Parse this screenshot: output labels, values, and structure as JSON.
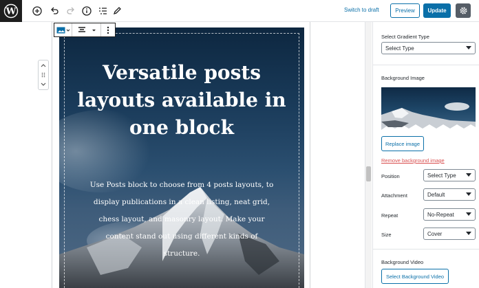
{
  "topbar": {
    "switch_to_draft": "Switch to draft",
    "preview": "Preview",
    "update": "Update"
  },
  "cover": {
    "title": "Versatile posts layouts available in one block",
    "text": "Use Posts block to choose from 4 posts layouts, to display publications in a clean listing, neat grid, chess layout, and masonry layout. Make your content stand out using different kinds of structure."
  },
  "sidebar": {
    "gradient_type_label": "Select Gradient Type",
    "gradient_type_value": "Select Type",
    "background_image_label": "Background Image",
    "replace_image": "Replace image",
    "remove_background_image": "Remove background image",
    "position_label": "Position",
    "position_value": "Select Type",
    "attachment_label": "Attachment",
    "attachment_value": "Default",
    "repeat_label": "Repeat",
    "repeat_value": "No-Repeat",
    "size_label": "Size",
    "size_value": "Cover",
    "background_video_label": "Background Video",
    "select_background_video": "Select Background Video"
  },
  "colors": {
    "accent": "#0a6fa8",
    "danger": "#d94f4f",
    "dark": "#1e1e1e"
  }
}
